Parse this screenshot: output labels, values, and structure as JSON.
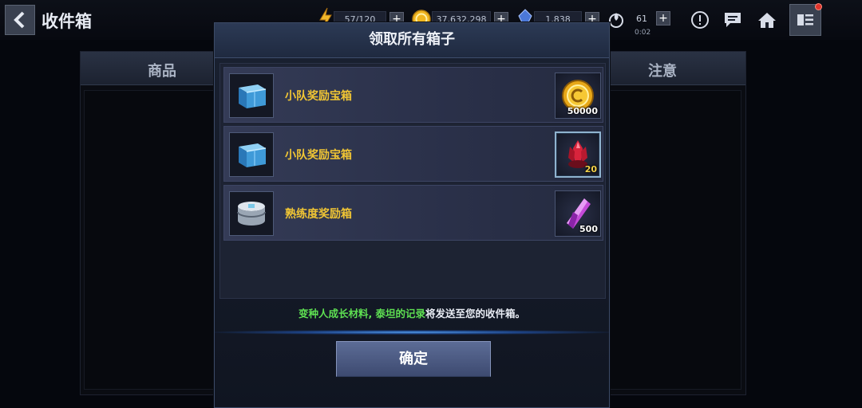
{
  "header": {
    "title": "收件箱",
    "energy": "57/120",
    "gold": "37,632,298",
    "crystals": "1,838",
    "timer_value": "61",
    "timer_sub": "0:02"
  },
  "background_panel": {
    "col_left": "商品",
    "col_right": "注意"
  },
  "modal": {
    "title": "领取所有箱子",
    "rows": [
      {
        "label": "小队奖励宝箱",
        "box_icon": "blue-box-icon",
        "reward_icon": "gold-coin-icon",
        "reward_qty": "50000"
      },
      {
        "label": "小队奖励宝箱",
        "box_icon": "blue-box-icon",
        "reward_icon": "red-crystal-icon",
        "reward_qty": "20"
      },
      {
        "label": "熟练度奖励箱",
        "box_icon": "silver-box-icon",
        "reward_icon": "purple-gem-icon",
        "reward_qty": "500"
      }
    ],
    "notice_highlight": "变种人成长材料, 泰坦的记录",
    "notice_rest": "将发送至您的收件箱。",
    "confirm_label": "确定"
  },
  "colors": {
    "item_label": "#f0c534",
    "highlight_text": "#5ee052",
    "accent_glow": "#3a8cff"
  }
}
